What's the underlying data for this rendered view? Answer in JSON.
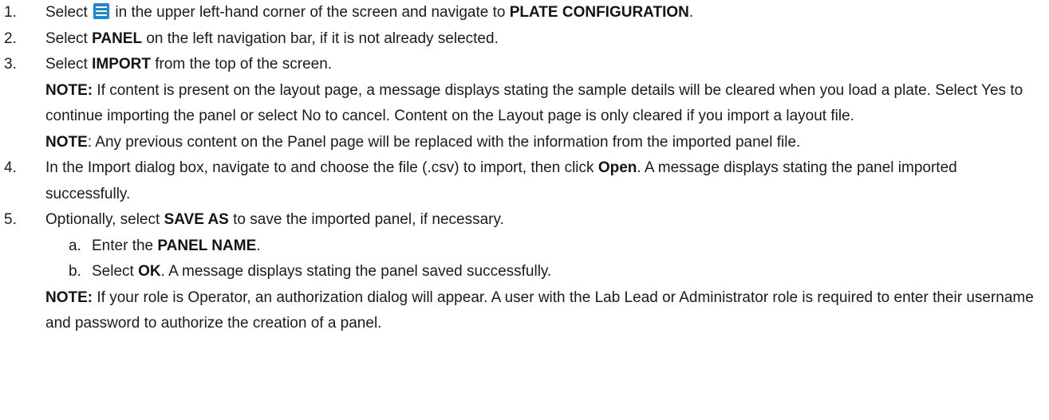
{
  "icons": {
    "menu": "hamburger-menu-icon",
    "menu_color": "#1e88d8"
  },
  "steps": [
    {
      "num": "1.",
      "a": "Select ",
      "b": " in the upper left-hand corner of the screen and navigate to ",
      "c": "PLATE CONFIGURATION",
      "d": "."
    },
    {
      "num": "2.",
      "a": "Select ",
      "b": "PANEL",
      "c": " on the left navigation bar, if it is not already selected."
    },
    {
      "num": "3.",
      "a": "Select ",
      "b": "IMPORT",
      "c": " from the top of the screen."
    },
    {
      "num": "4.",
      "a": "In the Import dialog box, navigate to and choose the file (.csv) to import, then click ",
      "b": "Open",
      "c": ". A message displays stating the panel imported successfully."
    },
    {
      "num": "5.",
      "a": "Optionally, select ",
      "b": "SAVE AS",
      "c": " to save the imported panel, if necessary."
    }
  ],
  "notes": [
    {
      "label": "NOTE:",
      "text": " If content is present on the layout page, a message displays stating the sample details will be cleared when you load a plate. Select Yes to continue importing the panel or select No to cancel. Content on the Layout page is only cleared if you import a layout file."
    },
    {
      "label": "NOTE",
      "text": ": Any previous content on the Panel page will be replaced with the information from the imported panel file."
    },
    {
      "label": "NOTE:",
      "text": " If your role is Operator, an authorization dialog will appear. A user with the Lab Lead or Administrator role is required to enter their username and password to authorize the creation of a panel."
    }
  ],
  "substeps": [
    {
      "num": "a.",
      "a": "Enter the ",
      "b": "PANEL NAME",
      "c": "."
    },
    {
      "num": "b.",
      "a": "Select ",
      "b": "OK",
      "c": ". A message displays stating the panel saved successfully."
    }
  ]
}
